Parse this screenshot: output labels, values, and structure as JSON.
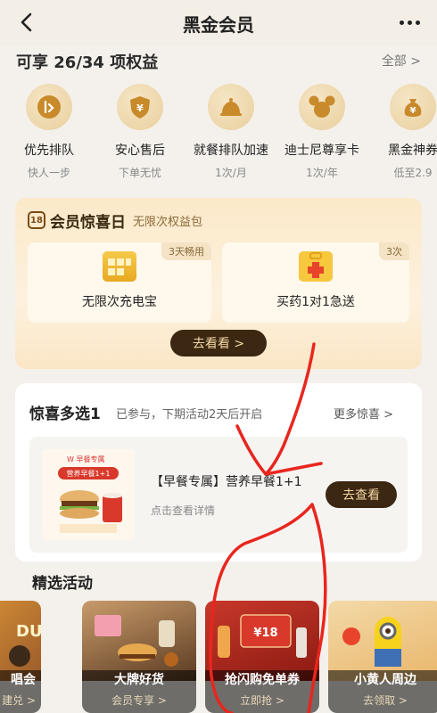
{
  "header": {
    "title": "黑金会员"
  },
  "benefits": {
    "title": "可享 26/34 项权益",
    "all_label": "全部 >",
    "items": [
      {
        "name": "优先排队",
        "sub": "快人一步",
        "icon": "queue-icon"
      },
      {
        "name": "安心售后",
        "sub": "下单无忧",
        "icon": "shield-icon"
      },
      {
        "name": "就餐排队加速",
        "sub": "1次/月",
        "icon": "dining-bell-icon"
      },
      {
        "name": "迪士尼尊享卡",
        "sub": "1次/年",
        "icon": "mickey-icon"
      },
      {
        "name": "黑金神券",
        "sub": "低至2.9",
        "icon": "money-bag-icon"
      }
    ]
  },
  "surprise_day": {
    "badge": "18",
    "title": "会员惊喜日",
    "subtitle": "无限次权益包",
    "items": [
      {
        "label": "无限次充电宝",
        "tag": "3天畅用"
      },
      {
        "label": "买药1对1急送",
        "tag": "3次"
      }
    ],
    "button": "去看看 >"
  },
  "multi_pick": {
    "title": "惊喜多选1",
    "subtitle": "已参与，下期活动2天后开启",
    "more": "更多惊喜 >",
    "product": {
      "name": "【早餐专属】营养早餐1+1",
      "detail": "点击查看详情",
      "button": "去查看",
      "image_brand": "W 早餐专属",
      "image_text": "营养早餐1+1"
    }
  },
  "activities": {
    "title": "精选活动",
    "items": [
      {
        "name": "唱会",
        "sub": "建兑 >",
        "badge": "DU"
      },
      {
        "name": "大牌好货",
        "sub": "会员专享 >"
      },
      {
        "name": "抢闪购免单券",
        "sub": "立即抢 >",
        "badge": "¥18"
      },
      {
        "name": "小黄人周边",
        "sub": "去领取 >"
      }
    ]
  },
  "colors": {
    "gold_button_bg": "#3b2712",
    "gold_text": "#f2d7a3",
    "annotation_red": "#e8261e"
  }
}
